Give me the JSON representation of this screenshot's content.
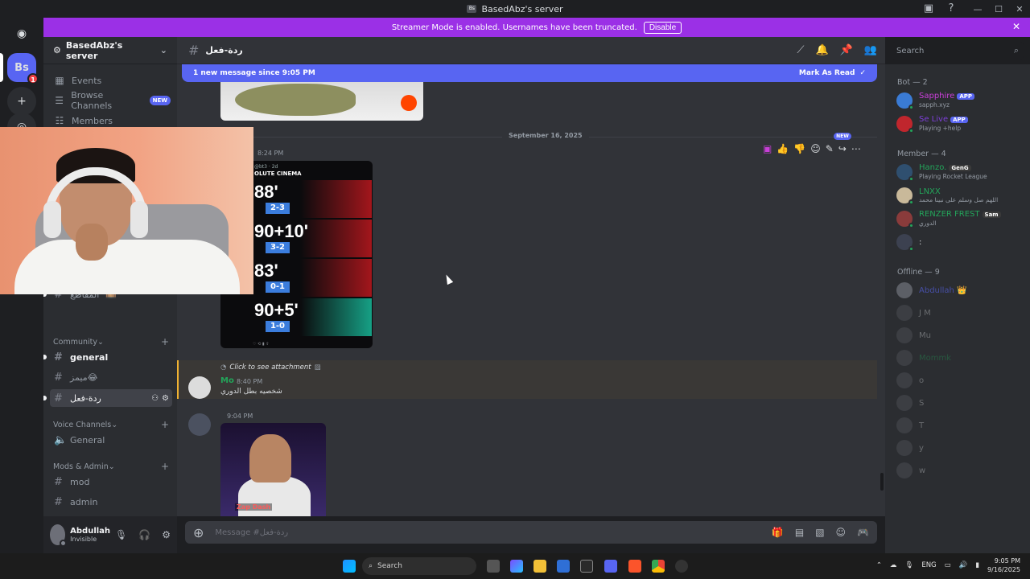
{
  "window": {
    "title": "BasedAbz's server",
    "server_icon": "Bs"
  },
  "banner": {
    "text": "Streamer Mode is enabled. Usernames have been truncated.",
    "disable_label": "Disable"
  },
  "rail": {
    "active_server": "Bs",
    "badge": "1"
  },
  "server": {
    "name": "BasedAbz's server"
  },
  "nav": [
    {
      "label": "Events",
      "icon": "calendar-icon"
    },
    {
      "label": "Browse Channels",
      "icon": "browse-icon",
      "badge": "NEW"
    },
    {
      "label": "Members",
      "icon": "members-icon"
    }
  ],
  "channels_top": [
    {
      "label": "المقاطع",
      "emoji": "🎞️"
    }
  ],
  "categories": {
    "community": "Community",
    "voice": "Voice Channels",
    "mods": "Mods & Admin"
  },
  "community_channels": [
    {
      "label": "general"
    },
    {
      "label": "ميمز😂"
    },
    {
      "label": "ردة-فعل"
    }
  ],
  "voice_channels": [
    {
      "label": "General"
    }
  ],
  "mod_channels": [
    {
      "label": "mod"
    },
    {
      "label": "admin"
    }
  ],
  "user": {
    "name": "Abdullah",
    "status": "Invisible"
  },
  "header": {
    "channel": "ردة-فعل"
  },
  "search": {
    "placeholder": "Search"
  },
  "chat": {
    "new_bar": "1 new message since 9:05 PM",
    "mark_read": "Mark As Read",
    "date": "September 16, 2025",
    "new_tag": "NEW",
    "msg1_time": "8:24 PM",
    "post_handle": "@bt3 · 2d",
    "post_title": "OLUTE CINEMA",
    "scores": [
      {
        "minute": "88'",
        "score": "2-3"
      },
      {
        "minute": "90+10'",
        "score": "3-2"
      },
      {
        "minute": "83'",
        "score": "0-1"
      },
      {
        "minute": "90+5'",
        "score": "1-0"
      }
    ],
    "reply_text": "Click to see attachment",
    "msg2_author": "Mo",
    "msg2_time": "8:40 PM",
    "msg2_text": "شخصيه بطل الدوري",
    "msg3_time": "9:04 PM",
    "video_caption": "Zap Dash"
  },
  "composer": {
    "placeholder": "Message #ردة-فعل"
  },
  "members": {
    "bot_header": "Bot — 2",
    "member_header": "Member — 4",
    "offline_header": "Offline — 9",
    "bots": [
      {
        "name": "Sapphire",
        "tag": "APP",
        "sub": "sapph.xyz",
        "color": "#c93fd8"
      },
      {
        "name": "Se Live",
        "tag": "APP",
        "sub": "Playing +help",
        "color": "#7d3fd8"
      }
    ],
    "online": [
      {
        "name": "Hanzo.",
        "tag": "GenG",
        "sub": "Playing Rocket League",
        "color": "#23a55a"
      },
      {
        "name": "LNXX",
        "tag": "",
        "sub": "اللهم صل وسلم على نبينا محمد",
        "color": "#23a55a"
      },
      {
        "name": "RENZER FREST",
        "tag": "Sam",
        "sub": "الدوري",
        "color": "#23a55a"
      },
      {
        "name": ":",
        "tag": "",
        "sub": "",
        "color": "#dbdee1"
      }
    ],
    "offline": [
      {
        "name": "Abdullah",
        "color": "#5865f2"
      },
      {
        "name": "J M",
        "color": "#949ba4"
      },
      {
        "name": "Mu",
        "color": "#949ba4"
      },
      {
        "name": "Mommk",
        "color": "#23a55a"
      },
      {
        "name": "o",
        "color": "#949ba4"
      },
      {
        "name": "S",
        "color": "#949ba4"
      },
      {
        "name": "T",
        "color": "#949ba4"
      },
      {
        "name": "y",
        "color": "#949ba4"
      },
      {
        "name": "w",
        "color": "#949ba4"
      }
    ]
  },
  "taskbar": {
    "search": "Search",
    "lang": "ENG",
    "time": "9:05 PM",
    "date": "9/16/2025"
  }
}
